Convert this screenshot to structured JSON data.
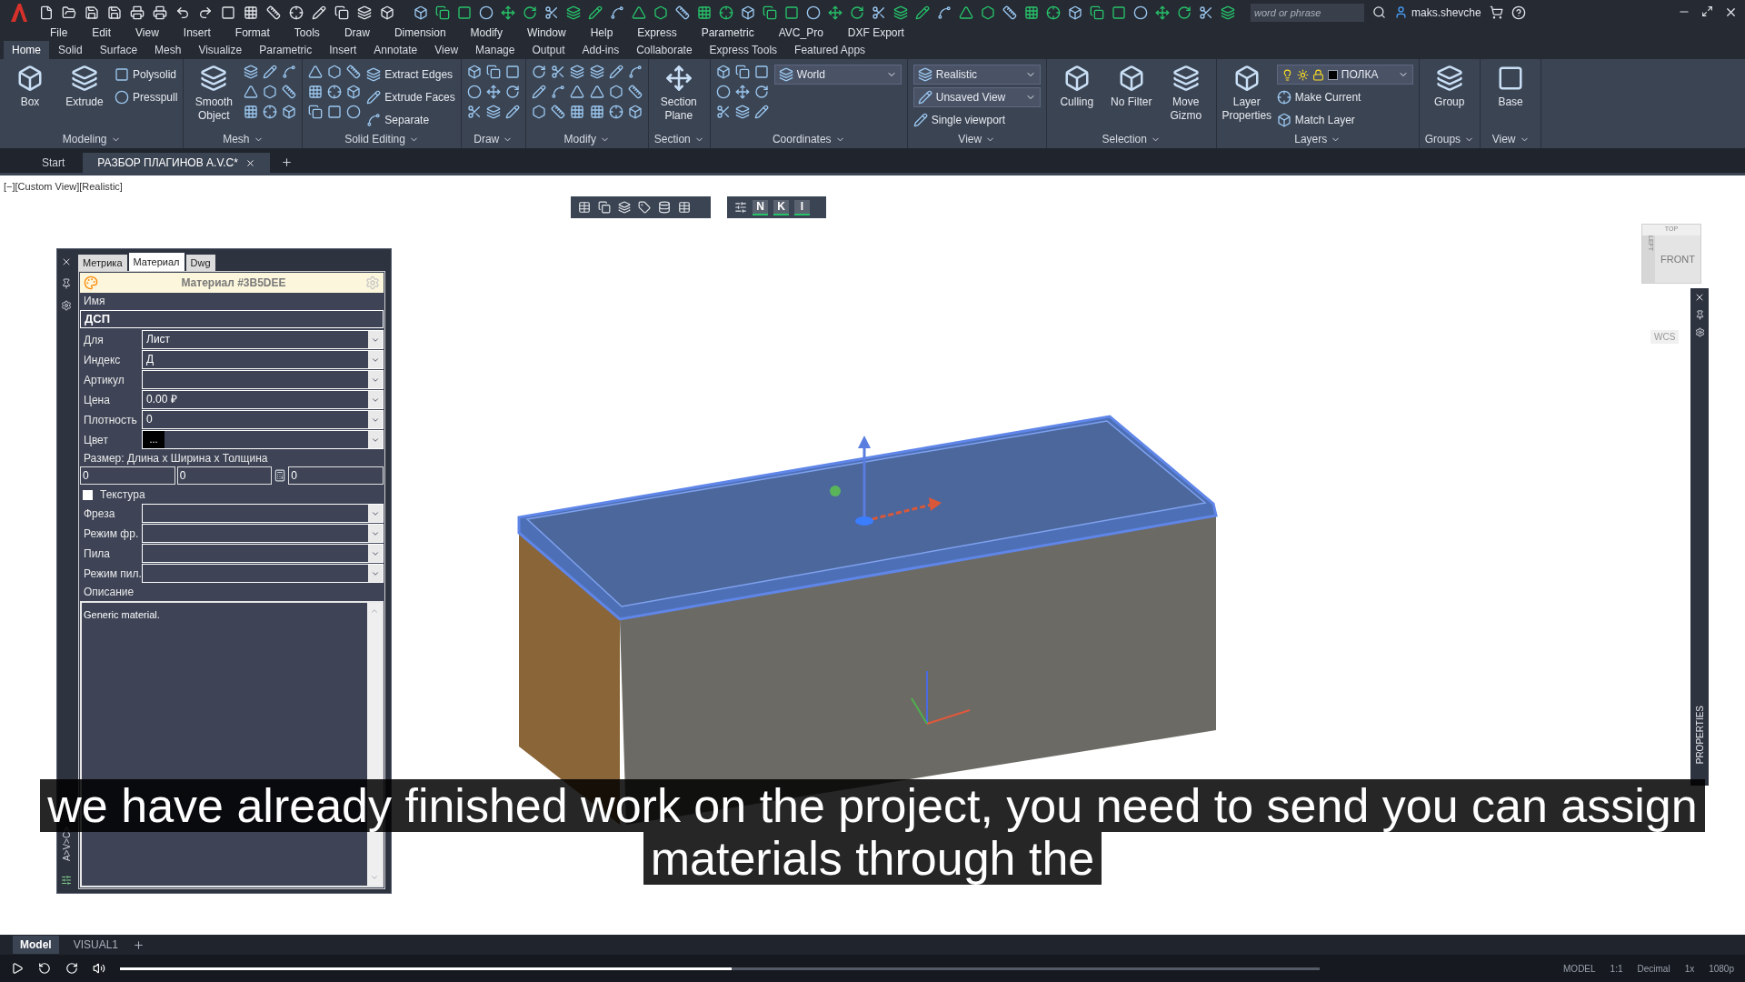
{
  "title_bar": {
    "search": {
      "placeholder": "word or phrase"
    },
    "user": "maks.shevche"
  },
  "menu": [
    "File",
    "Edit",
    "View",
    "Insert",
    "Format",
    "Tools",
    "Draw",
    "Dimension",
    "Modify",
    "Window",
    "Help",
    "Express",
    "Parametric",
    "AVC_Pro",
    "DXF Export"
  ],
  "ribbon_tabs": [
    {
      "label": "Home",
      "selected": true
    },
    {
      "label": "Solid",
      "selected": false
    },
    {
      "label": "Surface",
      "selected": false
    },
    {
      "label": "Mesh",
      "selected": false
    },
    {
      "label": "Visualize",
      "selected": false
    },
    {
      "label": "Parametric",
      "selected": false
    },
    {
      "label": "Insert",
      "selected": false
    },
    {
      "label": "Annotate",
      "selected": false
    },
    {
      "label": "View",
      "selected": false
    },
    {
      "label": "Manage",
      "selected": false
    },
    {
      "label": "Output",
      "selected": false
    },
    {
      "label": "Add-ins",
      "selected": false
    },
    {
      "label": "Collaborate",
      "selected": false
    },
    {
      "label": "Express Tools",
      "selected": false
    },
    {
      "label": "Featured Apps",
      "selected": false
    }
  ],
  "ribbon_panels": [
    {
      "title": "Modeling",
      "items": [
        {
          "kind": "large",
          "label": "Box"
        },
        {
          "kind": "large",
          "label": "Extrude"
        },
        {
          "kind": "small",
          "label": "Polysolid"
        },
        {
          "kind": "small",
          "label": "Presspull"
        }
      ]
    },
    {
      "title": "Mesh",
      "items": [
        {
          "kind": "large",
          "label": "Smooth Object"
        },
        {
          "kind": "icons"
        }
      ]
    },
    {
      "title": "Solid Editing",
      "items": [
        {
          "kind": "icons"
        },
        {
          "kind": "small",
          "label": "Extract Edges"
        },
        {
          "kind": "small",
          "label": "Extrude Faces"
        },
        {
          "kind": "small",
          "label": "Separate"
        }
      ]
    },
    {
      "title": "Draw",
      "items": [
        {
          "kind": "icons"
        }
      ]
    },
    {
      "title": "Modify",
      "items": [
        {
          "kind": "icons"
        },
        {
          "kind": "icons"
        }
      ]
    },
    {
      "title": "Section",
      "items": [
        {
          "kind": "large",
          "label": "Section Plane"
        }
      ]
    },
    {
      "title": "Coordinates",
      "items": [
        {
          "kind": "icons"
        },
        {
          "kind": "dropdown",
          "label": "World"
        }
      ]
    },
    {
      "title": "View",
      "items": [
        {
          "kind": "dropdown",
          "label": "Realistic"
        },
        {
          "kind": "dropdown",
          "label": "Unsaved View"
        },
        {
          "kind": "small",
          "label": "Single viewport"
        }
      ]
    },
    {
      "title": "Selection",
      "items": [
        {
          "kind": "large",
          "label": "Culling"
        },
        {
          "kind": "large",
          "label": "No Filter"
        },
        {
          "kind": "large",
          "label": "Move Gizmo"
        }
      ]
    },
    {
      "title": "Layers",
      "items": [
        {
          "kind": "large",
          "label": "Layer Properties"
        },
        {
          "kind": "layer",
          "label": "ПОЛКА",
          "color": "#000000"
        },
        {
          "kind": "small",
          "label": "Make Current"
        },
        {
          "kind": "small",
          "label": "Match Layer"
        }
      ]
    },
    {
      "title": "Groups",
      "items": [
        {
          "kind": "large",
          "label": "Group"
        }
      ]
    },
    {
      "title": "View",
      "items": [
        {
          "kind": "large",
          "label": "Base"
        }
      ]
    }
  ],
  "doc_tabs": [
    {
      "label": "Start",
      "selected": false
    },
    {
      "label": "РАЗБОР ПЛАГИНОВ A.V.C*",
      "selected": true
    }
  ],
  "viewport": {
    "label": "[−][Custom View][Realistic]",
    "toolbar_letters": [
      "N",
      "K",
      "I"
    ],
    "viewcube": {
      "top": "TOP",
      "left": "LEFT",
      "front": "FRONT"
    },
    "wcs": "WCS",
    "properties_strip": "PROPERTIES"
  },
  "palette": {
    "side_label": "A>V>C>",
    "tabs": [
      {
        "label": "Метрика",
        "selected": false
      },
      {
        "label": "Материал",
        "selected": true
      },
      {
        "label": "Dwg",
        "selected": false
      }
    ],
    "header": "Материал #3B5DEE",
    "name_label": "Имя",
    "name_value": "ДСП",
    "rows": [
      {
        "kind": "select",
        "label": "Для",
        "value": "Лист"
      },
      {
        "kind": "select",
        "label": "Индекс",
        "value": "Д"
      },
      {
        "kind": "select",
        "label": "Артикул"
      },
      {
        "kind": "select",
        "label": "Цена",
        "value": "0.00 ₽"
      },
      {
        "kind": "select",
        "label": "Плотность",
        "value": "0"
      },
      {
        "kind": "color",
        "label": "Цвет",
        "swatch": "...",
        "color": "#000000"
      }
    ],
    "size_label": "Размер: Длина x Ширина x Толщина",
    "size_values": [
      "0",
      "0",
      "0"
    ],
    "texture": {
      "label": "Текстура",
      "checked": false
    },
    "rows2": [
      {
        "kind": "select",
        "label": "Фреза"
      },
      {
        "kind": "select",
        "label": "Режим фр."
      },
      {
        "kind": "select",
        "label": "Пила"
      },
      {
        "kind": "select",
        "label": "Режим пил."
      }
    ],
    "description_label": "Описание",
    "description": "Generic material."
  },
  "subtitles": [
    "we have already finished work on the project, you need to send you can assign",
    "materials through the"
  ],
  "layout_tabs": [
    {
      "label": "Model",
      "selected": true
    },
    {
      "label": "VISUAL1",
      "selected": false
    }
  ],
  "player": {
    "level": 0.51
  },
  "status_bar": [
    "MODEL",
    "1:1",
    "Decimal",
    "1x",
    "1080p"
  ]
}
